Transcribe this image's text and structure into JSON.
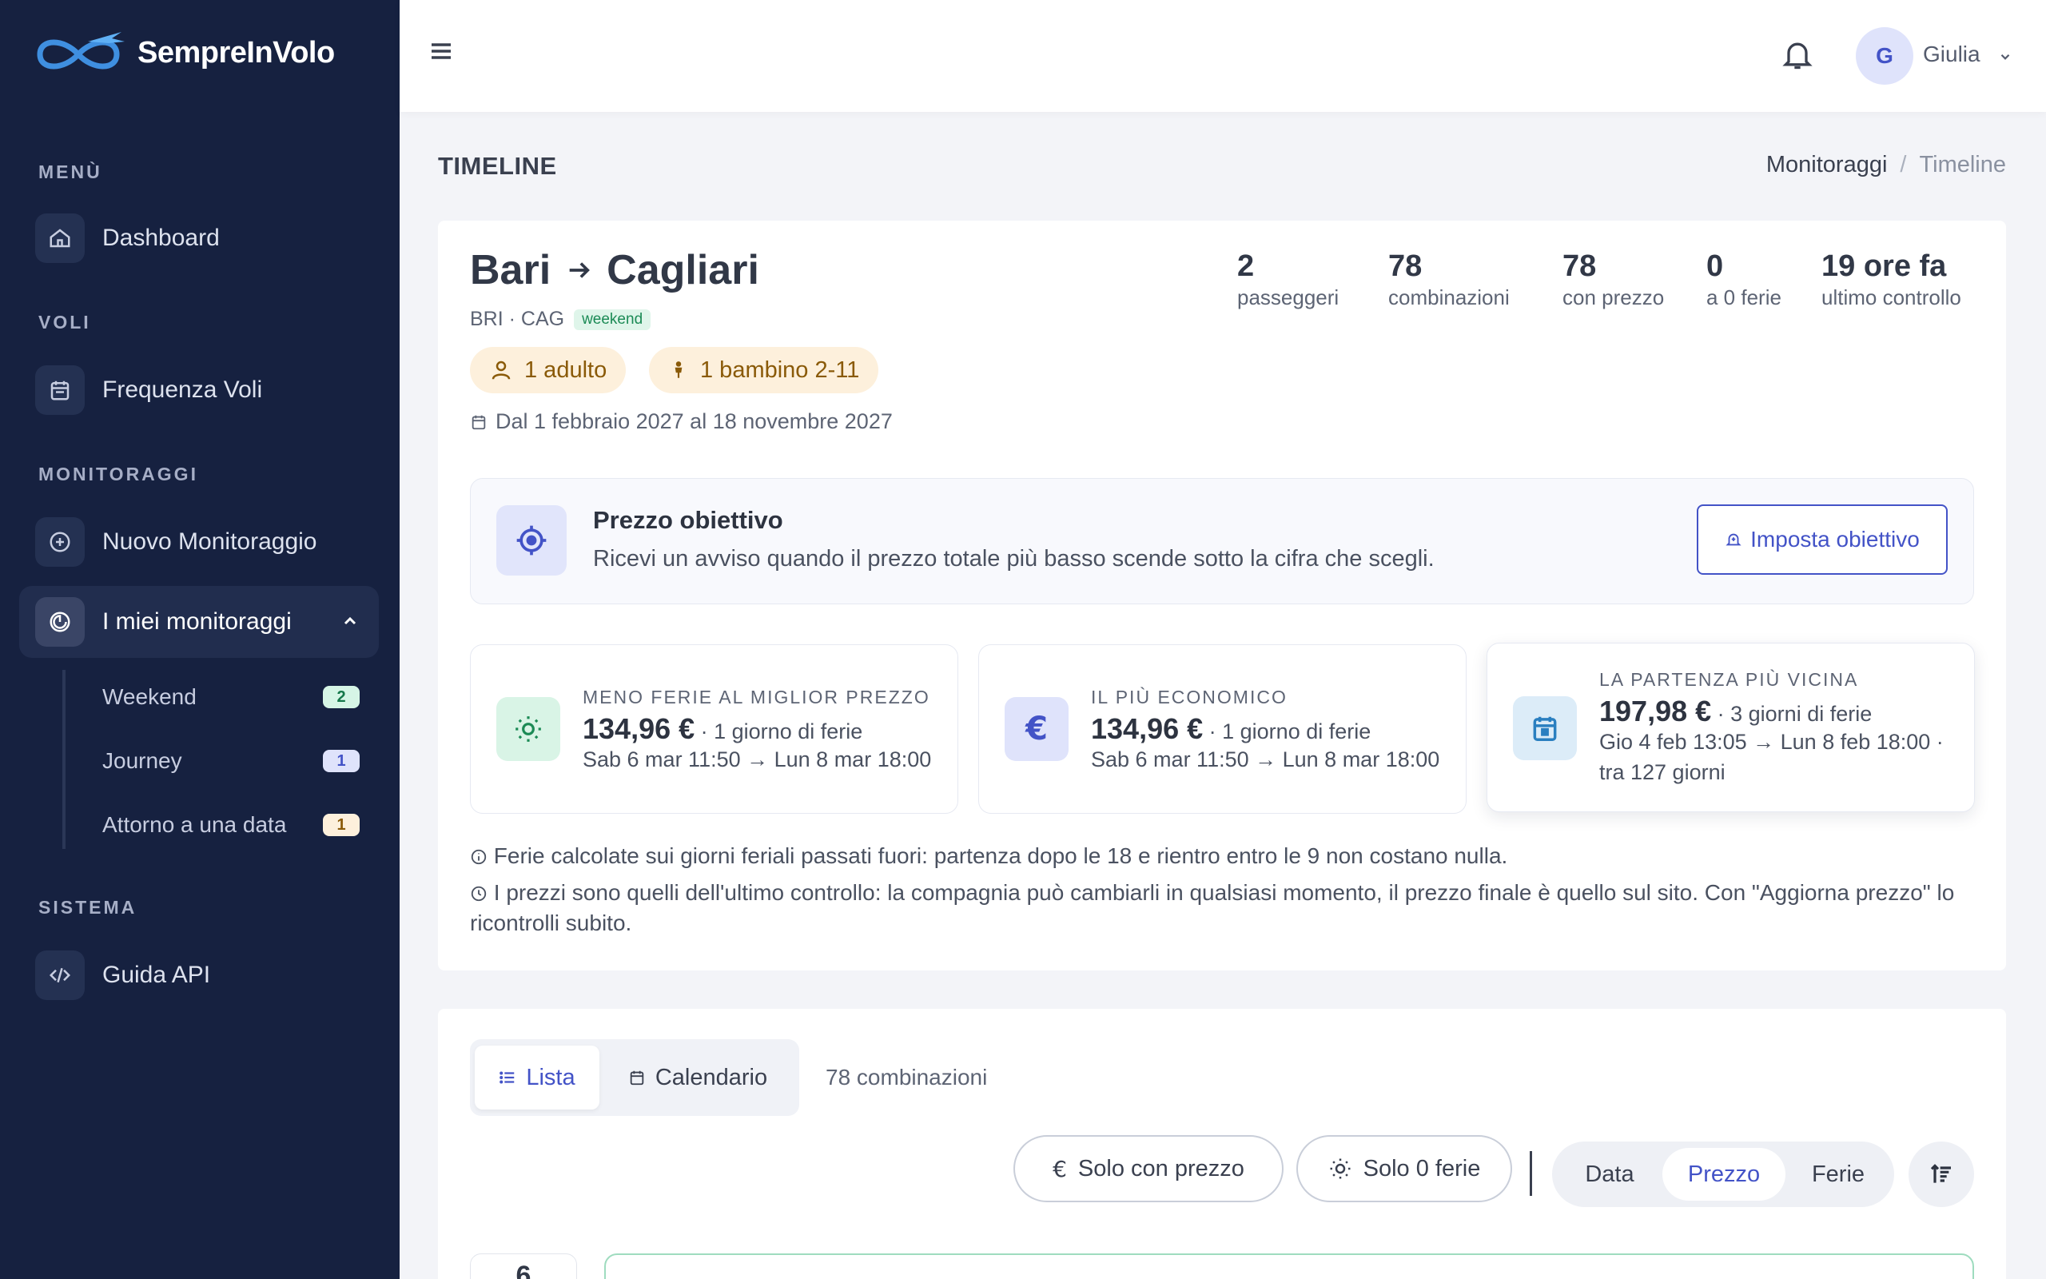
{
  "brand": {
    "name": "SempreInVolo"
  },
  "sidebar": {
    "sections": {
      "menu": "MENÙ",
      "voli": "VOLI",
      "monitoraggi": "MONITORAGGI",
      "sistema": "SISTEMA"
    },
    "items": {
      "dashboard": "Dashboard",
      "frequenza": "Frequenza Voli",
      "nuovo": "Nuovo Monitoraggio",
      "miei": "I miei monitoraggi",
      "guida": "Guida API"
    },
    "sub_items": [
      {
        "label": "Weekend",
        "count": "2"
      },
      {
        "label": "Journey",
        "count": "1"
      },
      {
        "label": "Attorno a una data",
        "count": "1"
      }
    ]
  },
  "topbar": {
    "avatar_initial": "G",
    "user_name": "Giulia"
  },
  "page": {
    "title": "TIMELINE",
    "breadcrumb": {
      "parent": "Monitoraggi",
      "sep": "/",
      "current": "Timeline"
    }
  },
  "route": {
    "origin": "Bari",
    "destination": "Cagliari",
    "codes": "BRI · CAG",
    "tag": "weekend",
    "adults": "1 adulto",
    "children": "1 bambino 2-11",
    "date_range": "Dal 1 febbraio 2027 al 18 novembre 2027"
  },
  "stats": [
    {
      "value": "2",
      "label": "passeggeri"
    },
    {
      "value": "78",
      "label": "combinazioni"
    },
    {
      "value": "78",
      "label": "con prezzo"
    },
    {
      "value": "0",
      "label": "a 0 ferie"
    },
    {
      "value": "19 ore fa",
      "label": "ultimo controllo"
    }
  ],
  "target": {
    "title": "Prezzo obiettivo",
    "description": "Ricevi un avviso quando il prezzo totale più basso scende sotto la cifra che scegli.",
    "button": "Imposta obiettivo"
  },
  "highlights": [
    {
      "label": "MENO FERIE AL MIGLIOR PREZZO",
      "price": "134,96 €",
      "extra": " · 1 giorno di ferie",
      "detail": "Sab 6 mar 11:50 → Lun 8 mar 18:00",
      "color": "#1b8a55"
    },
    {
      "label": "IL PIÙ ECONOMICO",
      "price": "134,96 €",
      "extra": " · 1 giorno di ferie",
      "detail": "Sab 6 mar 11:50 → Lun 8 mar 18:00",
      "color": "#4353c7"
    },
    {
      "label": "LA PARTENZA PIÙ VICINA",
      "price": "197,98 €",
      "extra": " · 3 giorni di ferie",
      "detail": "Gio 4 feb 13:05 → Lun 8 feb 18:00 · tra 127 giorni",
      "color": "#2a7fc0"
    }
  ],
  "notes": {
    "ferie": "Ferie calcolate sui giorni feriali passati fuori: partenza dopo le 18 e rientro entro le 9 non costano nulla.",
    "prezzi": "I prezzi sono quelli dell'ultimo controllo: la compagnia può cambiarli in qualsiasi momento, il prezzo finale è quello sul sito. Con \"Aggiorna prezzo\" lo ricontrolli subito."
  },
  "list": {
    "view_list": "Lista",
    "view_calendar": "Calendario",
    "count": "78 combinazioni",
    "filter_price": "Solo con prezzo",
    "filter_ferie": "Solo 0 ferie",
    "sort": {
      "data": "Data",
      "prezzo": "Prezzo",
      "ferie": "Ferie"
    },
    "first_row_day": "6"
  }
}
